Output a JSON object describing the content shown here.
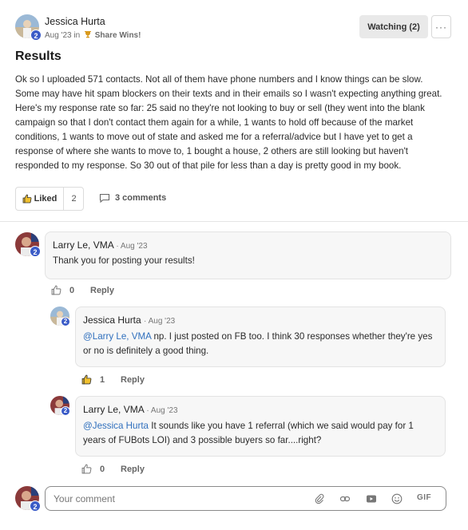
{
  "post": {
    "author": "Jessica Hurta",
    "level": "2",
    "date": "Aug '23",
    "in_text": "in",
    "category": "Share Wins!",
    "watching_label": "Watching (2)",
    "more_label": "···",
    "title": "Results",
    "body": "Ok so I uploaded 571 contacts. Not all of them have phone numbers and I know things can be slow. Some may have hit spam blockers on their texts and in their emails so I wasn't expecting anything great. Here's my response rate so far: 25 said no they're not looking to buy or sell (they went into the blank campaign so that I don't contact them again for a while, 1 wants to hold off because of the market conditions, 1 wants to move out of state and asked me for a referral/advice but I have yet to get a response of where she wants to move to, 1 bought a house, 2 others are still looking but haven't responded to my response. So 30 out of that pile for less than a day is pretty good in my book.",
    "liked_label": "Liked",
    "like_count": "2",
    "comments_label": "3 comments"
  },
  "comments": [
    {
      "author": "Larry Le, VMA",
      "time": "· Aug '23",
      "level": "2",
      "mention": "",
      "text": "Thank you for posting your results!",
      "like_count": "0",
      "reply_label": "Reply"
    },
    {
      "author": "Jessica Hurta",
      "time": "· Aug '23",
      "level": "2",
      "mention": "@Larry Le, VMA",
      "text": " np. I just posted on FB too. I think 30 responses whether they're yes or no is definitely a good thing.",
      "like_count": "1",
      "reply_label": "Reply"
    },
    {
      "author": "Larry Le, VMA",
      "time": "· Aug '23",
      "level": "2",
      "mention": "@Jessica Hurta",
      "text": " It sounds like you have 1 referral (which we said would pay for 1 years of FUBots LOI) and 3 possible buyers so far....right?",
      "like_count": "0",
      "reply_label": "Reply"
    }
  ],
  "composer": {
    "placeholder": "Your comment",
    "level": "2",
    "gif_label": "GIF"
  },
  "colors": {
    "accent_link": "#2f6fbd",
    "level_badge": "#3a5bc7"
  }
}
